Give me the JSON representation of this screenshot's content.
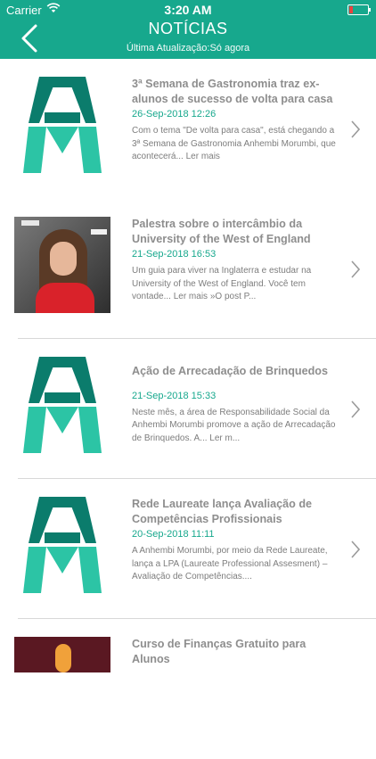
{
  "status_bar": {
    "carrier": "Carrier",
    "time": "3:20 AM"
  },
  "header": {
    "title": "NOTÍCIAS",
    "subtitle": "Última Atualização:Só agora",
    "background": "#17a88d"
  },
  "news": [
    {
      "title": "3ª Semana de Gastronomia traz ex-alunos de sucesso de volta para casa",
      "date": "26-Sep-2018 12:26",
      "summary": "Com o tema \"De volta para casa\", está chegando a 3ª Semana de Gastronomia Anhembi Morumbi, que acontecerá... Ler mais"
    },
    {
      "title": "Palestra sobre o intercâmbio da University of the West of England",
      "date": "21-Sep-2018 16:53",
      "summary": "Um guia para viver na Inglaterra e estudar na University of the West of England. Você tem vontade... Ler mais »O post P..."
    },
    {
      "title": "Ação de Arrecadação de Brinquedos",
      "date": "21-Sep-2018 15:33",
      "summary": "Neste mês, a área de Responsabilidade Social da Anhembi Morumbi promove a ação de Arrecadação de Brinquedos. A... Ler m..."
    },
    {
      "title": "Rede Laureate lança Avaliação de Competências Profissionais",
      "date": "20-Sep-2018 11:11",
      "summary": "A Anhembi Morumbi, por meio da Rede Laureate, lança a LPA (Laureate Professional Assesment) – Avaliação de Competências...."
    },
    {
      "title": "Curso de Finanças Gratuito para Alunos"
    }
  ],
  "colors": {
    "accent": "#17a88d",
    "title_text": "#8e8e8e",
    "logo_dark": "#0b7c6c",
    "logo_light": "#2cc4a5"
  },
  "icons": {
    "back": "chevron-left-icon",
    "row": "chevron-right-icon",
    "logo": "am-logo"
  }
}
